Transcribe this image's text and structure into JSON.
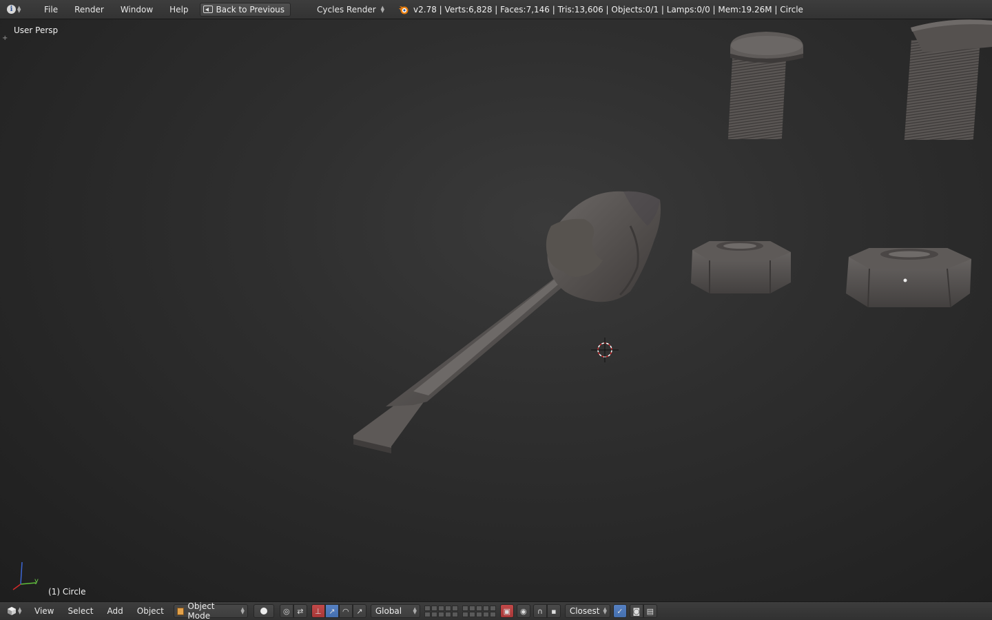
{
  "topbar": {
    "editor_icon": "info-icon",
    "menu": [
      "File",
      "Render",
      "Window",
      "Help"
    ],
    "back_button": "Back to Previous",
    "render_engine": "Cycles Render",
    "stats": "v2.78 | Verts:6,828 | Faces:7,146 | Tris:13,606 | Objects:0/1 | Lamps:0/0 | Mem:19.26M | Circle"
  },
  "viewport": {
    "view_name": "User Persp",
    "active_object": "(1) Circle",
    "axis_y": "y",
    "objects": [
      "screwdriver",
      "bolt-round-head",
      "bolt-countersunk",
      "hex-nut-left",
      "hex-nut-right",
      "3d-cursor"
    ]
  },
  "bottombar": {
    "editor_icon": "3d-view-icon",
    "menu": [
      "View",
      "Select",
      "Add",
      "Object"
    ],
    "mode": "Object Mode",
    "transform_orientation": "Global",
    "snap_target": "Closest"
  },
  "colors": {
    "header_bg": "#3a3a3a",
    "viewport_bg": "#2b2b2b",
    "active_blue": "#5680c2",
    "mode_orange": "#e2a14a",
    "mesh_gray": "#5a5654"
  }
}
